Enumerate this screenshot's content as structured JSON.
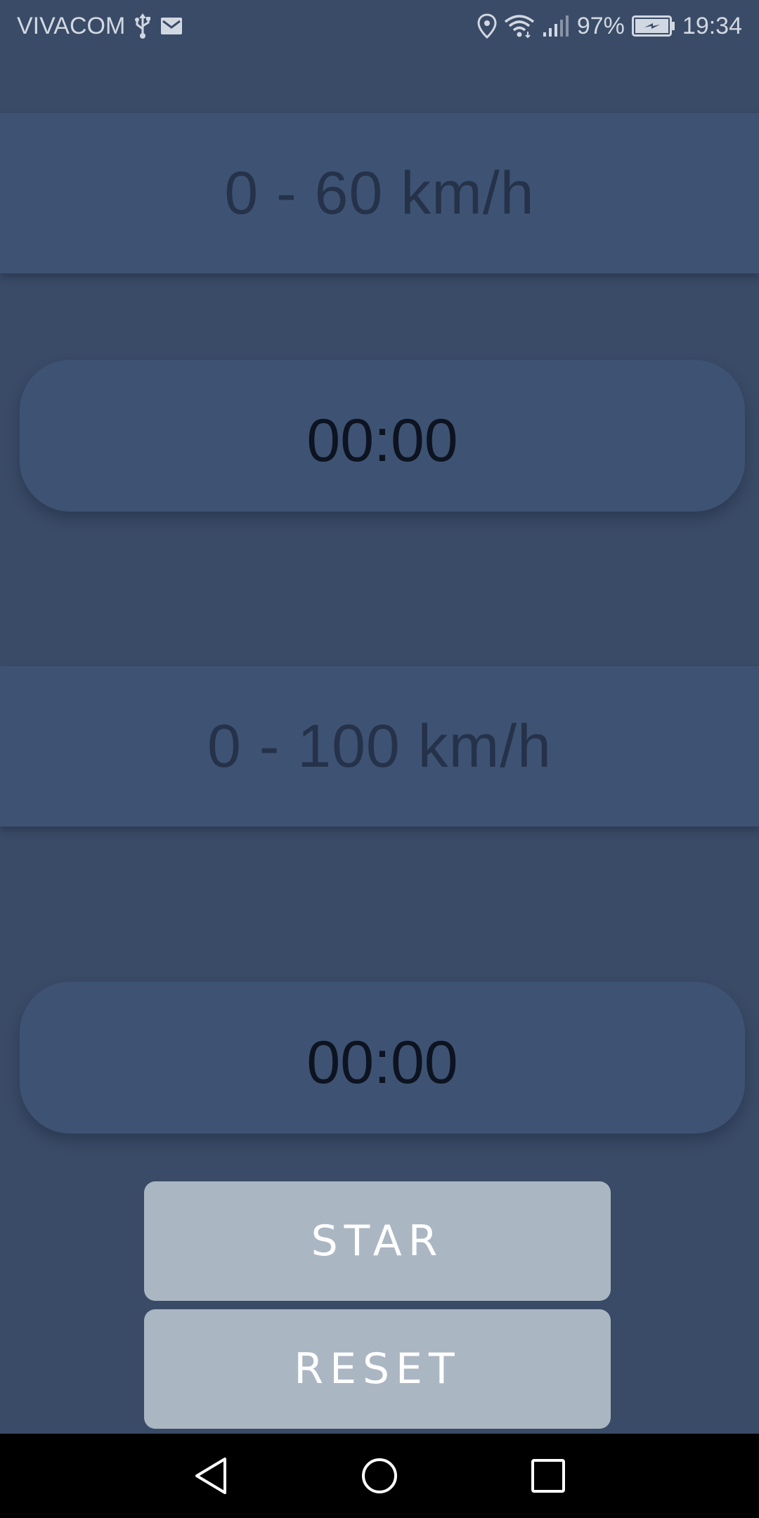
{
  "status_bar": {
    "carrier": "VIVACOM",
    "battery_percent": "97%",
    "time": "19:34",
    "icons": {
      "usb": "usb-icon",
      "mail": "mail-icon",
      "location": "location-icon",
      "wifi": "wifi-icon",
      "signal": "signal-icon",
      "battery": "battery-charging-icon"
    }
  },
  "sections": [
    {
      "label": "0 - 60 km/h",
      "time": "00:00"
    },
    {
      "label": "0 - 100 km/h",
      "time": "00:00"
    }
  ],
  "buttons": {
    "start_label": "STAR",
    "reset_label": "RESET"
  },
  "nav": {
    "back": "back-icon",
    "home": "home-icon",
    "recent": "recent-apps-icon"
  },
  "colors": {
    "background": "#3a4b67",
    "band": "#3e5373",
    "button": "#abb6c3"
  }
}
